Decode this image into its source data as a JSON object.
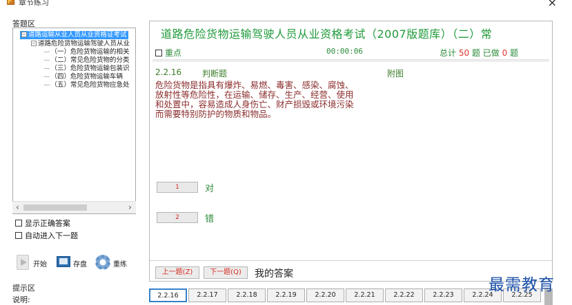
{
  "window": {
    "title": "章节练习",
    "close_glyph": "×"
  },
  "left": {
    "answer_area_label": "答题区",
    "tree": [
      {
        "label": "道路运输从业人员从业资格证考试",
        "toggle": "−",
        "selected": true
      },
      {
        "label": "道路危险货物运输驾驶人员从业",
        "toggle": "−"
      },
      {
        "label": "（一）危险货物运输的相关",
        "dash": "—"
      },
      {
        "label": "（二）常见危险货物的分类",
        "dash": "—"
      },
      {
        "label": "（三）危险货物运输包装识",
        "dash": "—"
      },
      {
        "label": "（四）危险货物运输车辆",
        "dash": "—"
      },
      {
        "label": "（五）常见危险货物应急处",
        "dash": "—"
      }
    ],
    "scroll_left": "‹",
    "scroll_right": "›",
    "show_answer_label": "显示正确答案",
    "auto_next_label": "自动进入下一题",
    "tools": {
      "start": "开始",
      "save": "存盘",
      "retry": "重练"
    },
    "hint_label": "提示区",
    "description_label": "说明:"
  },
  "question": {
    "exam_title": "道路危险货物运输驾驶人员从业资格考试（2007版题库）（二）常",
    "focus_label": "重点",
    "timer": "00:00:06",
    "total_label": "总计",
    "total": "50",
    "question_unit": "题",
    "done_label": "已做",
    "done": "0",
    "number": "2.2.16",
    "type": "判断题",
    "figure_label": "附图",
    "lines": [
      "危险货物是指具有爆炸、易燃、毒害、感染、腐蚀、",
      "放射性等危险性，在运输、储存、生产、经营、使用",
      "和处置中，容易造成人身伤亡、财产损毁或环境污染",
      "而需要特别防护的物质和物品。"
    ],
    "options": [
      {
        "key": "1",
        "label": "对"
      },
      {
        "key": "2",
        "label": "错"
      }
    ],
    "prev_label": "上一题(Z)",
    "next_label": "下一题(Q)",
    "my_answer_label": "我的答案"
  },
  "tabs": [
    "2.2.16",
    "2.2.17",
    "2.2.18",
    "2.2.19",
    "2.2.20",
    "2.2.21",
    "2.2.22",
    "2.2.23",
    "2.2.24",
    "2.2.25"
  ],
  "watermark": "最需教育",
  "colors": {
    "title_green": "#1f9a3a",
    "question_red": "#8b2c2c",
    "number_red": "#e0342a",
    "tree_selected": "#3399ff"
  }
}
